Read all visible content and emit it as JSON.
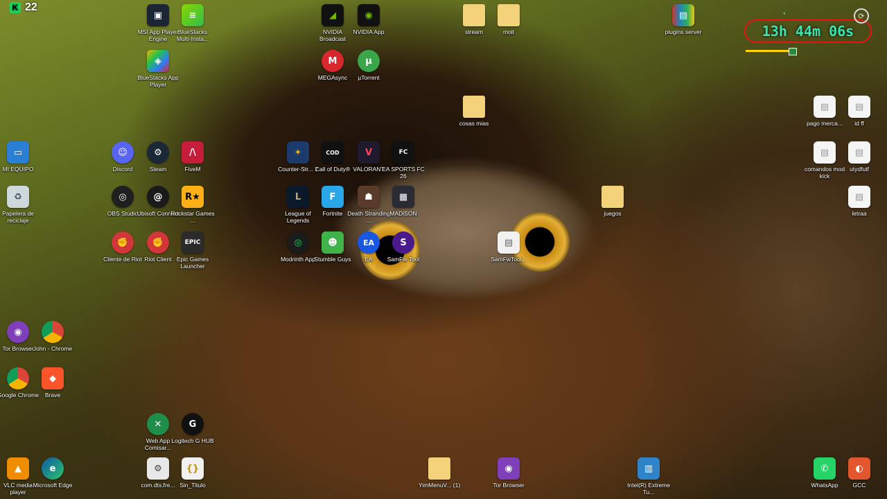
{
  "overlay": {
    "counter_icon": "K",
    "counter_value": "22",
    "timer": "13h 44m 06s"
  },
  "icons": {
    "msi": "MSI App Player Engine",
    "bluestacks_multi": "BlueStacks Multi-Insta...",
    "bluestacks_app": "BlueStacks App Player",
    "nvidia_broadcast": "NVIDIA Broadcast",
    "nvidia_app": "NVIDIA App",
    "megasync": "MEGAsync",
    "utorrent": "µTorrent",
    "stream": "stream",
    "moit": "moit",
    "plugins_server": "plugins server",
    "cosas_mias": "cosas mias",
    "pago_merca": "pago merca...",
    "id_ff": "id ff",
    "mi_equipo": "MI EQUIPO",
    "papelera": "Papelera de reciclaje",
    "discord": "Discord",
    "steam": "Steam",
    "fivem": "FiveM",
    "obs": "OBS Studio",
    "ubisoft": "Ubisoft Connect",
    "rockstar": "Rockstar Games ...",
    "cliente_riot": "Cliente de Riot",
    "riot_client": "Riot Client",
    "epic": "Epic Games Launcher",
    "cs2": "Counter-Str... 2",
    "cod": "Call of Duty®",
    "valorant": "VALORANT",
    "fc26": "EA SPORTS FC 26",
    "lol": "League of Legends",
    "fortnite": "Fortnite",
    "death_stranding": "Death Stranding ...",
    "madison": "MADiSON",
    "juegos": "juegos",
    "modrinth": "Modrinth App",
    "stumble": "Stumble Guys",
    "ea": "EA",
    "samfw": "SamFw Tool",
    "samfw_tool": "SamFwTool...",
    "comandos": "comandos mod kick",
    "utydfutf": "utydfutf",
    "letraa": "letraa",
    "tor_browser_left": "Tor Browser",
    "john_chrome": "John - Chrome",
    "google_chrome": "Google Chrome",
    "brave": "Brave",
    "web_app": "Web App Comisar...",
    "logitech": "Logitech G HUB",
    "vlc": "VLC media player",
    "edge": "Microsoft Edge",
    "dts": "com.dts.fre...",
    "sin_titulo": "Sin_Titulo",
    "yimmenu": "YimMenuV... (1)",
    "tor_browser_bottom": "Tor Browser",
    "intel": "Intel(R) Extreme Tu...",
    "whatsapp": "WhatsApp",
    "gcc": "GCC"
  },
  "colors": {
    "timer_text": "#38e6b2",
    "timer_border": "#ee1111",
    "counter_badge": "#1ed760"
  }
}
